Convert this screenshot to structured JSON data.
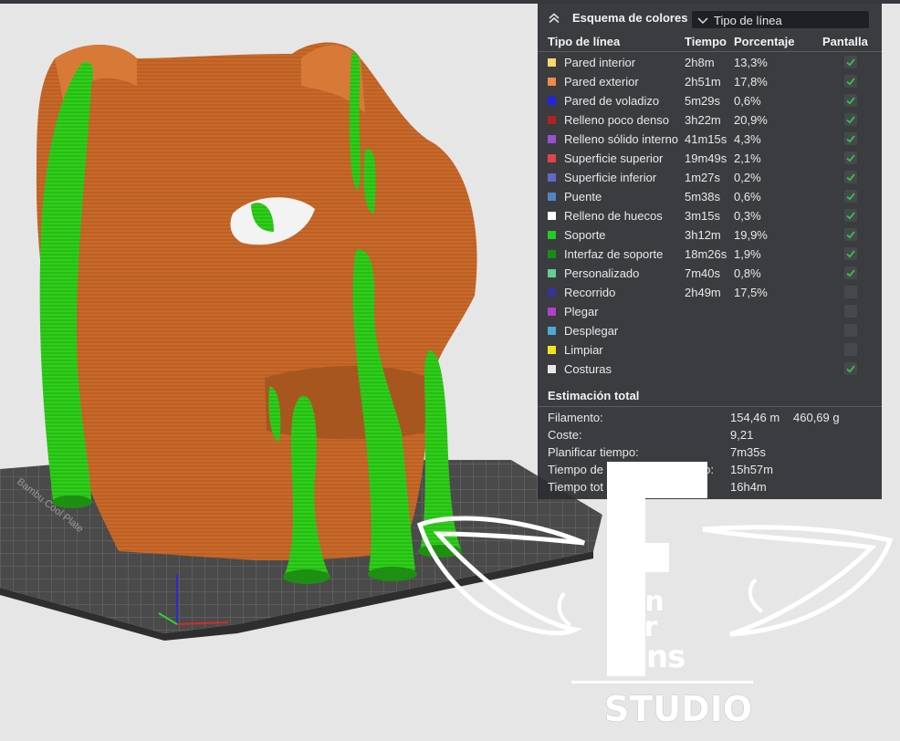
{
  "legend": {
    "title": "Esquema de colores",
    "view_mode": "Tipo de línea",
    "columns": {
      "type": "Tipo de línea",
      "time": "Tiempo",
      "percent": "Porcentaje",
      "display": "Pantalla"
    },
    "rows": [
      {
        "name": "Pared interior",
        "time": "2h8m",
        "percent": "13,3%",
        "color": "#f5d76e",
        "checked": true
      },
      {
        "name": "Pared exterior",
        "time": "2h51m",
        "percent": "17,8%",
        "color": "#f08a4b",
        "checked": true
      },
      {
        "name": "Pared de voladizo",
        "time": "5m29s",
        "percent": "0,6%",
        "color": "#2222e6",
        "checked": true
      },
      {
        "name": "Relleno poco denso",
        "time": "3h22m",
        "percent": "20,9%",
        "color": "#b22222",
        "checked": true
      },
      {
        "name": "Relleno sólido interno",
        "time": "41m15s",
        "percent": "4,3%",
        "color": "#9b4fd0",
        "checked": true
      },
      {
        "name": "Superficie superior",
        "time": "19m49s",
        "percent": "2,1%",
        "color": "#e04545",
        "checked": true
      },
      {
        "name": "Superficie inferior",
        "time": "1m27s",
        "percent": "0,2%",
        "color": "#6666cc",
        "checked": true
      },
      {
        "name": "Puente",
        "time": "5m38s",
        "percent": "0,6%",
        "color": "#4f86c6",
        "checked": true
      },
      {
        "name": "Relleno de huecos",
        "time": "3m15s",
        "percent": "0,3%",
        "color": "#ffffff",
        "checked": true
      },
      {
        "name": "Soporte",
        "time": "3h12m",
        "percent": "19,9%",
        "color": "#22cc22",
        "checked": true
      },
      {
        "name": "Interfaz de soporte",
        "time": "18m26s",
        "percent": "1,9%",
        "color": "#1a8a1a",
        "checked": true
      },
      {
        "name": "Personalizado",
        "time": "7m40s",
        "percent": "0,8%",
        "color": "#66cc99",
        "checked": true
      },
      {
        "name": "Recorrido",
        "time": "2h49m",
        "percent": "17,5%",
        "color": "#33339a",
        "checked": false
      },
      {
        "name": "Plegar",
        "time": "",
        "percent": "",
        "color": "#b040d0",
        "checked": false
      },
      {
        "name": "Desplegar",
        "time": "",
        "percent": "",
        "color": "#4fa8d8",
        "checked": false
      },
      {
        "name": "Limpiar",
        "time": "",
        "percent": "",
        "color": "#f2e422",
        "checked": false
      },
      {
        "name": "Costuras",
        "time": "",
        "percent": "",
        "color": "#e8e8e8",
        "checked": true
      }
    ]
  },
  "summary": {
    "title": "Estimación total",
    "filament_label": "Filamento:",
    "filament_length": "154,46 m",
    "filament_weight": "460,69 g",
    "cost_label": "Coste:",
    "cost_value": "9,21",
    "plan_label": "Planificar tiempo:",
    "plan_value": "7m35s",
    "model_label": "Tiempo de",
    "model_label_tail": "elo:",
    "model_value": "15h57m",
    "total_label": "Tiempo tot",
    "total_value": "16h4m"
  },
  "watermark": {
    "lines": [
      "un",
      "or",
      "ans"
    ],
    "studio": "STUDIO"
  },
  "colors": {
    "model_orange": "#c8692a",
    "support_green": "#2fcf1a",
    "bed_gray": "#4a4a4a",
    "checkbox_check": "#33c24a"
  }
}
